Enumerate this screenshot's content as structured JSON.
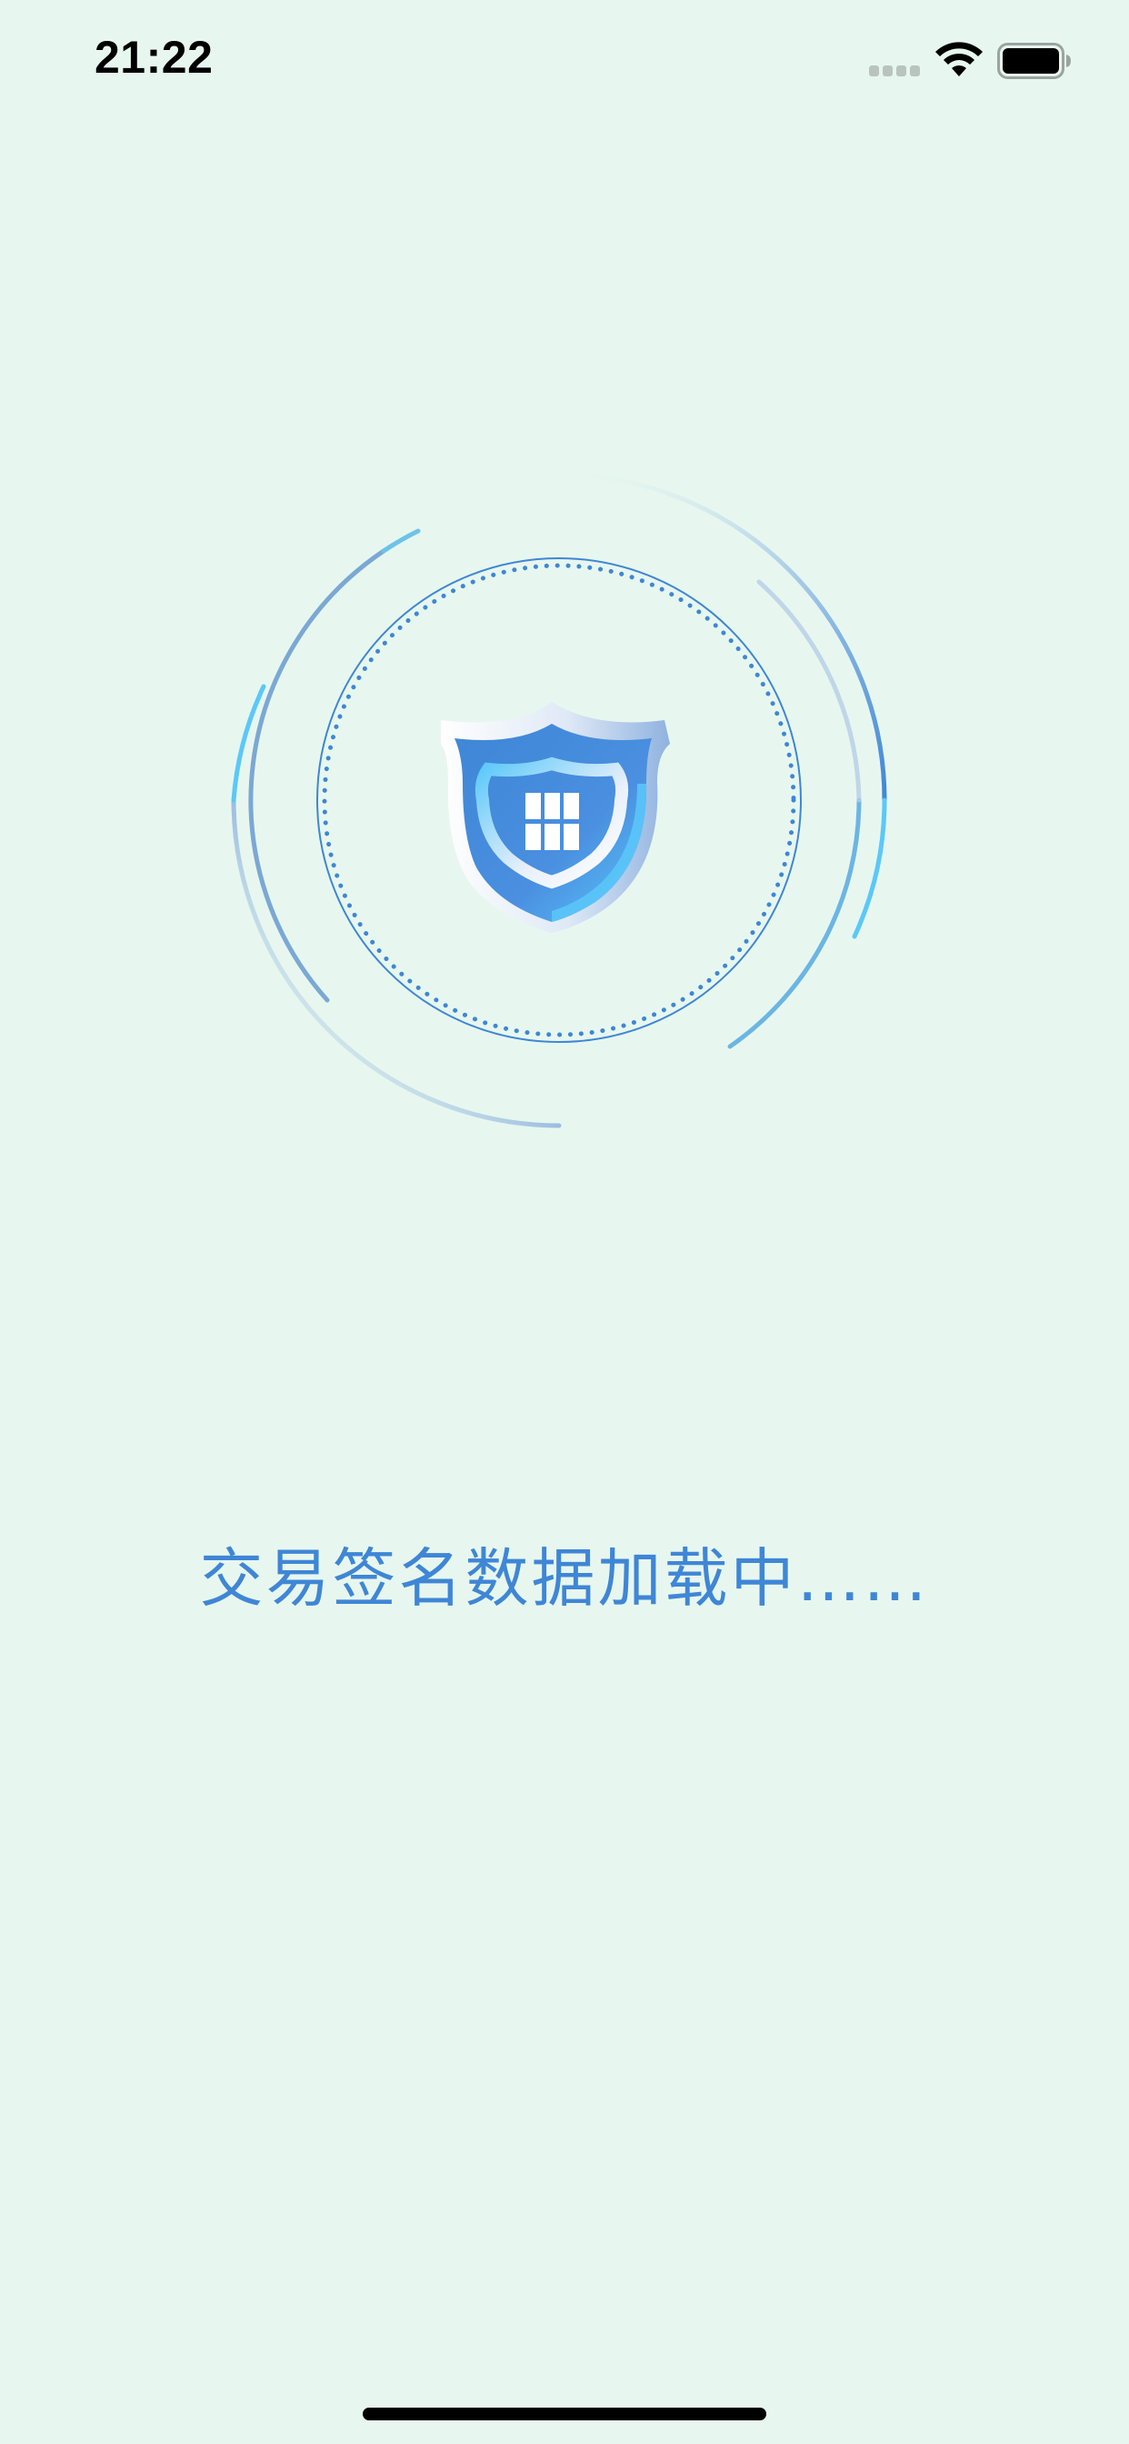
{
  "status_bar": {
    "time": "21:22",
    "icons": [
      "cellular-signal-icon",
      "wifi-icon",
      "battery-icon"
    ]
  },
  "loader": {
    "icon": "shield-icon",
    "state": "loading"
  },
  "loading_text": "交易签名数据加载中……",
  "colors": {
    "background": "#e7f7ef",
    "accent": "#3f86d6",
    "accent_light": "#5ac8fa",
    "text_dark": "#000000"
  }
}
